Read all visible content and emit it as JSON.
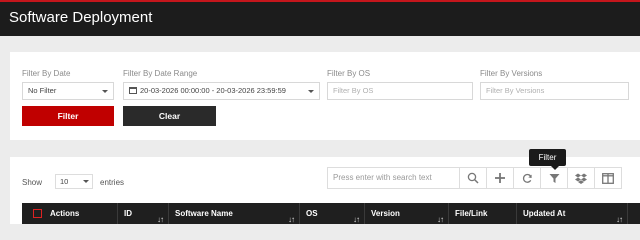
{
  "page": {
    "title": "Software Deployment"
  },
  "filters": {
    "by_date": {
      "label": "Filter By Date",
      "value": "No Filter"
    },
    "by_date_range": {
      "label": "Filter By Date Range",
      "value": "20-03-2026 00:00:00 - 20-03-2026 23:59:59"
    },
    "by_os": {
      "label": "Filter By OS",
      "placeholder": "Filter By OS"
    },
    "by_versions": {
      "label": "Filter By Versions",
      "placeholder": "Filter By Versions"
    },
    "filter_button": "Filter",
    "clear_button": "Clear"
  },
  "table_controls": {
    "show_label": "Show",
    "page_length": "10",
    "entries_label": "entries",
    "search_placeholder": "Press enter with search text",
    "tooltip": "Filter",
    "tool_icons": [
      "search-icon",
      "plus-icon",
      "refresh-icon",
      "filter-icon",
      "dropbox-icon",
      "columns-icon"
    ]
  },
  "table": {
    "columns": [
      "Actions",
      "ID",
      "Software Name",
      "OS",
      "Version",
      "File/Link",
      "Updated At"
    ]
  },
  "colors": {
    "accent_red": "#c00000",
    "topbar": "#1c1c1c",
    "header_dark": "#1f1f1f"
  }
}
